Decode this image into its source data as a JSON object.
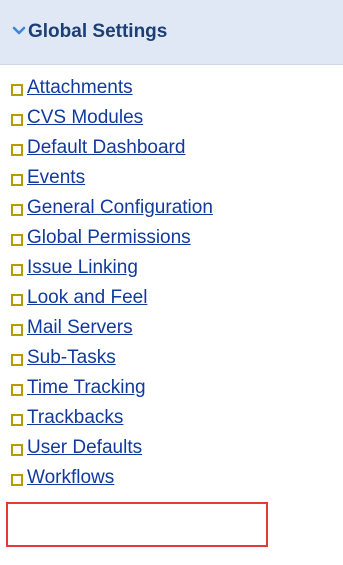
{
  "header": {
    "title": "Global Settings",
    "collapse_icon": "chevron-down-icon"
  },
  "items": [
    {
      "label": "Attachments"
    },
    {
      "label": "CVS Modules"
    },
    {
      "label": "Default Dashboard"
    },
    {
      "label": "Events"
    },
    {
      "label": "General Configuration"
    },
    {
      "label": "Global Permissions"
    },
    {
      "label": "Issue Linking"
    },
    {
      "label": "Look and Feel"
    },
    {
      "label": "Mail Servers"
    },
    {
      "label": "Sub-Tasks"
    },
    {
      "label": "Time Tracking"
    },
    {
      "label": "Trackbacks"
    },
    {
      "label": "User Defaults"
    },
    {
      "label": "Workflows"
    }
  ],
  "highlighted_item": "Workflows",
  "colors": {
    "header_background": "#dfe8f4",
    "header_text": "#1c3f75",
    "chevron": "#3d86d8",
    "link": "#123a9e",
    "bullet": "#b39b00",
    "highlight": "#e53935"
  }
}
